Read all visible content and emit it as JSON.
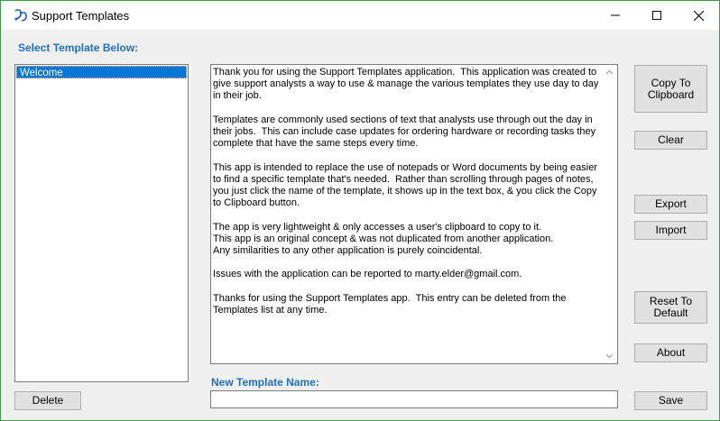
{
  "window": {
    "title": "Support Templates",
    "controls": {
      "minimize": "minimize-icon",
      "maximize": "maximize-icon",
      "close": "close-icon"
    }
  },
  "left": {
    "label": "Select Template Below:",
    "templates": [
      "Welcome"
    ],
    "delete_label": "Delete"
  },
  "editor": {
    "text": "Thank you for using the Support Templates application.  This application was created to give support analysts a way to use & manage the various templates they use day to day in their job.\n\nTemplates are commonly used sections of text that analysts use through out the day in their jobs.  This can include case updates for ordering hardware or recording tasks they complete that have the same steps every time.\n\nThis app is intended to replace the use of notepads or Word documents by being easier to find a specific template that's needed.  Rather than scrolling through pages of notes, you just click the name of the template, it shows up in the text box, & you click the Copy to Clipboard button.\n\nThe app is very lightweight & only accesses a user's clipboard to copy to it.\nThis app is an original concept & was not duplicated from another application.\nAny similarities to any other application is purely coincidental.\n\nIssues with the application can be reported to marty.elder@gmail.com.\n\nThanks for using the Support Templates app.  This entry can be deleted from the Templates list at any time.",
    "new_name_label": "New Template Name:",
    "new_name_value": ""
  },
  "buttons": {
    "copy": "Copy To\nClipboard",
    "clear": "Clear",
    "export": "Export",
    "import": "Import",
    "reset": "Reset To\nDefault",
    "about": "About",
    "save": "Save"
  },
  "colors": {
    "accent": "#1f6fc5",
    "selection": "#0078d7",
    "border": "#3a9a48"
  }
}
